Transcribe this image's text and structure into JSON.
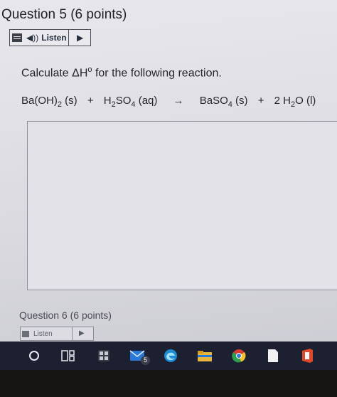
{
  "question": {
    "title": "Question 5",
    "points": "(6 points)",
    "listen_label": "Listen",
    "prompt_prefix": "Calculate ΔH",
    "prompt_sup": "o",
    "prompt_suffix": " for the following reaction.",
    "equation": {
      "r1_a": "Ba(OH)",
      "r1_sub": "2",
      "r1_state": " (s)",
      "plus1": "+",
      "r2_a": "H",
      "r2_sub1": "2",
      "r2_b": "SO",
      "r2_sub2": "4",
      "r2_state": " (aq)",
      "arrow": "→",
      "p1_a": "BaSO",
      "p1_sub": "4",
      "p1_state": " (s)",
      "plus2": "+",
      "p2_a": "2 H",
      "p2_sub": "2",
      "p2_b": "O",
      "p2_state": " (l)"
    },
    "answer_value": ""
  },
  "next_question": {
    "title": "Question 6",
    "points": "(6 points)",
    "listen_label": "Listen"
  },
  "taskbar": {
    "items": [
      "start-icon",
      "task-view-icon",
      "calculator-icon",
      "mail-icon",
      "edge-icon",
      "file-explorer-icon",
      "chrome-icon",
      "notes-icon",
      "office-icon"
    ],
    "mail_badge": "5"
  },
  "colors": {
    "taskbar": "#1d2030",
    "accent_blue": "#2a78d6",
    "chrome_red": "#d93b2f",
    "office_orange": "#e0482b"
  }
}
